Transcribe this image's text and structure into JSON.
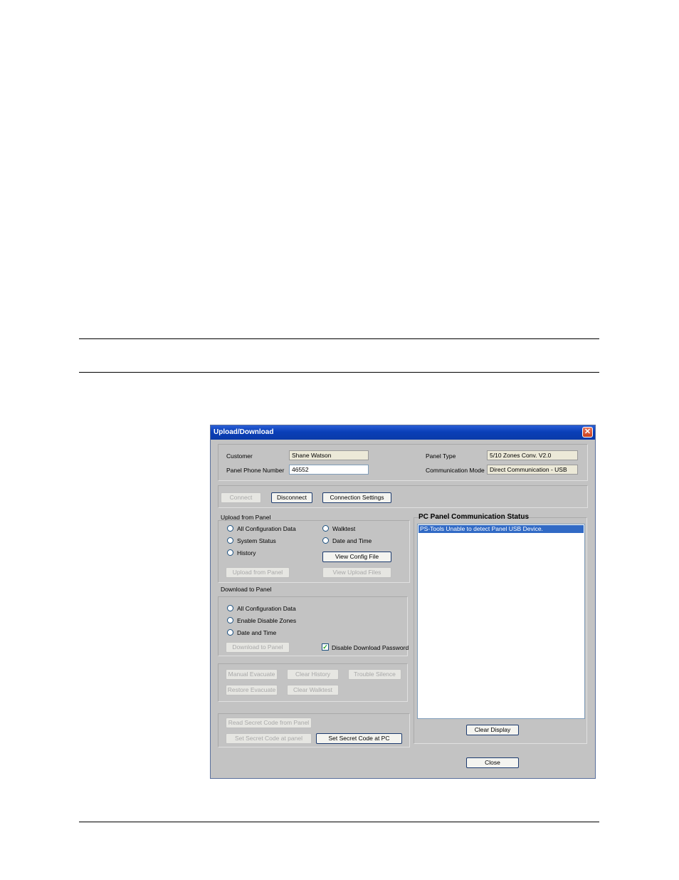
{
  "window": {
    "title": "Upload/Download",
    "close_glyph": "✕"
  },
  "info": {
    "customer_label": "Customer",
    "customer_value": "Shane Watson",
    "phone_label": "Panel Phone Number",
    "phone_value": "46552",
    "panel_type_label": "Panel Type",
    "panel_type_value": "5/10 Zones Conv. V2.0",
    "comm_mode_label": "Communication Mode",
    "comm_mode_value": "Direct Communication - USB"
  },
  "connection": {
    "connect": "Connect",
    "disconnect": "Disconnect",
    "settings": "Connection Settings"
  },
  "upload": {
    "heading": "Upload from Panel",
    "all_config": "All Configuration Data",
    "system_status": "System Status",
    "history": "History",
    "walktest": "Walktest",
    "date_time": "Date and Time",
    "view_config": "View Config File",
    "upload_button": "Upload from Panel",
    "view_upload": "View Upload Files"
  },
  "download": {
    "heading": "Download to Panel",
    "all_config": "All Configuration Data",
    "enable_disable": "Enable Disable Zones",
    "date_time": "Date and Time",
    "download_button": "Download to Panel",
    "disable_pw": "Disable Download Password",
    "disable_pw_checked": true,
    "check_glyph": "✓"
  },
  "actions": {
    "manual_evacuate": "Manual Evacuate",
    "clear_history": "Clear History",
    "trouble_silence": "Trouble Silence",
    "restore_evacuate": "Restore Evacuate",
    "clear_walktest": "Clear Walktest"
  },
  "secret": {
    "read": "Read Secret Code from Panel",
    "set_panel": "Set Secret Code at panel",
    "set_pc": "Set Secret Code at PC"
  },
  "status": {
    "heading": "PC Panel Communication Status",
    "lines": [
      "PS-Tools Unable to detect Panel USB Device."
    ],
    "clear": "Clear Display"
  },
  "footer": {
    "close": "Close"
  }
}
